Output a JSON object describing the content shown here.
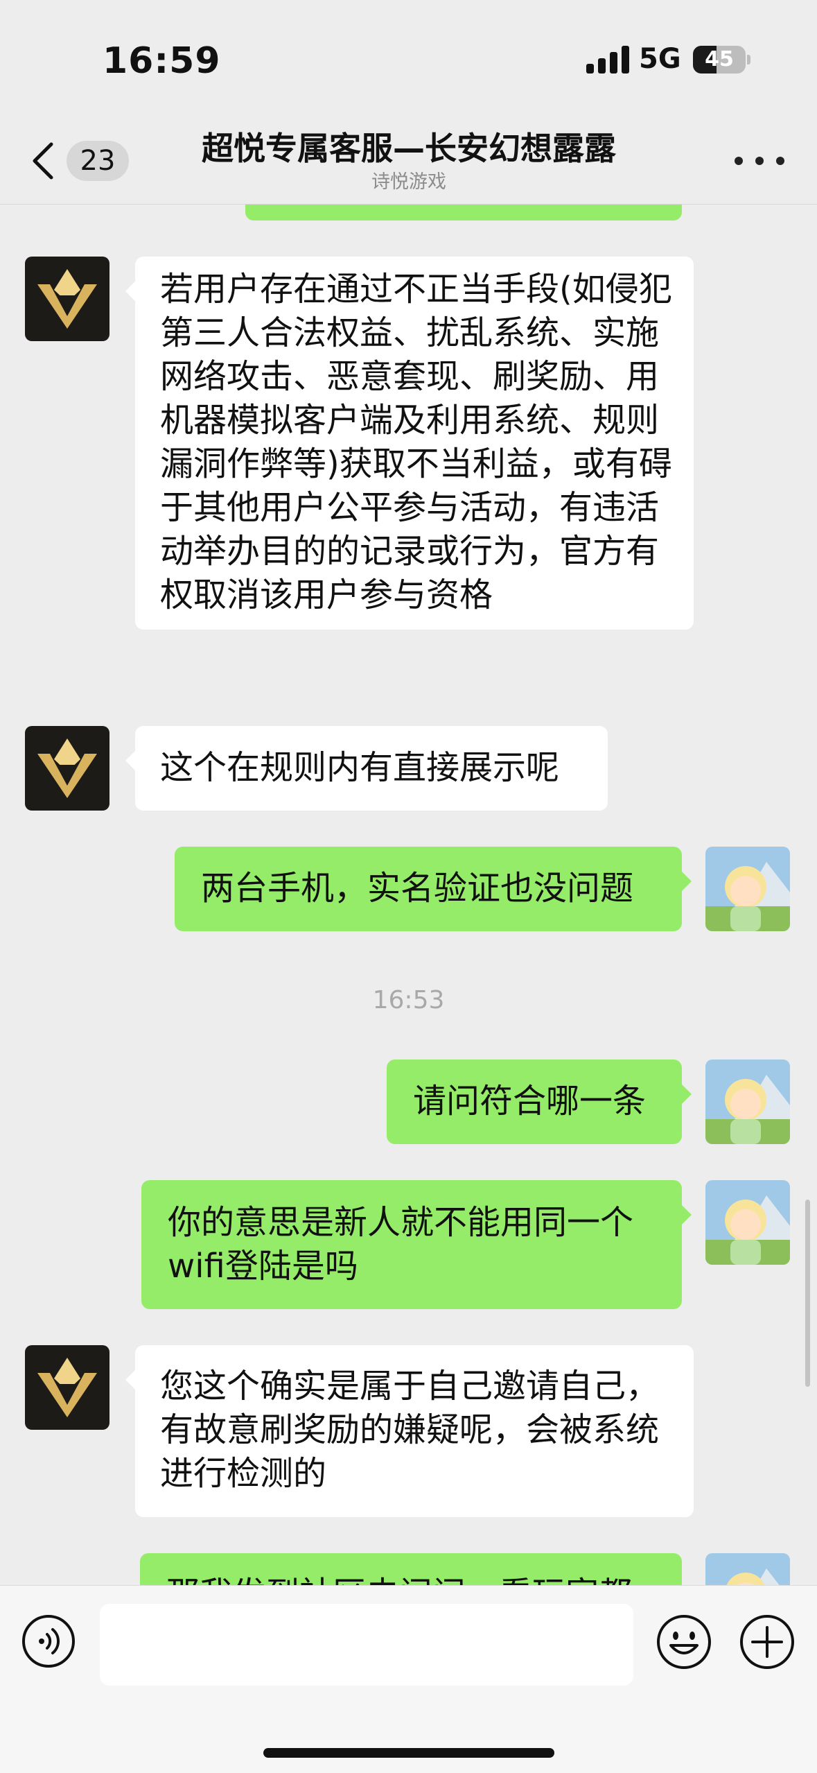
{
  "status_bar": {
    "time": "16:59",
    "network": "5G",
    "battery_level": "45",
    "battery_fraction": 0.45
  },
  "nav": {
    "unread_count": "23",
    "title": "超悦专属客服—长安幻想露露",
    "subtitle": "诗悦游戏"
  },
  "messages": [
    {
      "from": "agent",
      "text": "若用户存在通过不正当手段(如侵犯第三人合法权益、扰乱系统、实施网络攻击、恶意套现、刷奖励、用机器模拟客户端及利用系统、规则漏洞作弊等)获取不当利益，或有碍于其他用户公平参与活动，有违活动举办目的的记录或行为，官方有权取消该用户参与资格"
    },
    {
      "from": "agent",
      "text": "这个在规则内有直接展示呢"
    },
    {
      "from": "me",
      "text": "两台手机，实名验证也没问题"
    },
    {
      "from": "me",
      "text": "请问符合哪一条"
    },
    {
      "from": "me",
      "text": "你的意思是新人就不能用同一个wifi登陆是吗"
    },
    {
      "from": "agent",
      "text": "您这个确实是属于自己邀请自己，有故意刷奖励的嫌疑呢，会被系统进行检测的"
    },
    {
      "from": "me",
      "text": "那我发到社区去问问，看玩家都"
    }
  ],
  "timestamps": {
    "t1": "16:53"
  },
  "input": {
    "value": "",
    "placeholder": ""
  },
  "colors": {
    "background": "#ededed",
    "outgoing_bubble": "#95ec69",
    "incoming_bubble": "#ffffff",
    "agent_avatar_bg": "#1d1b17",
    "agent_logo_gold": "#d9b25e"
  },
  "icons": [
    "signal-icon",
    "battery-icon",
    "back-icon",
    "more-icon",
    "agent-logo-icon",
    "user-avatar-icon",
    "voice-icon",
    "emoji-icon",
    "plus-icon"
  ]
}
